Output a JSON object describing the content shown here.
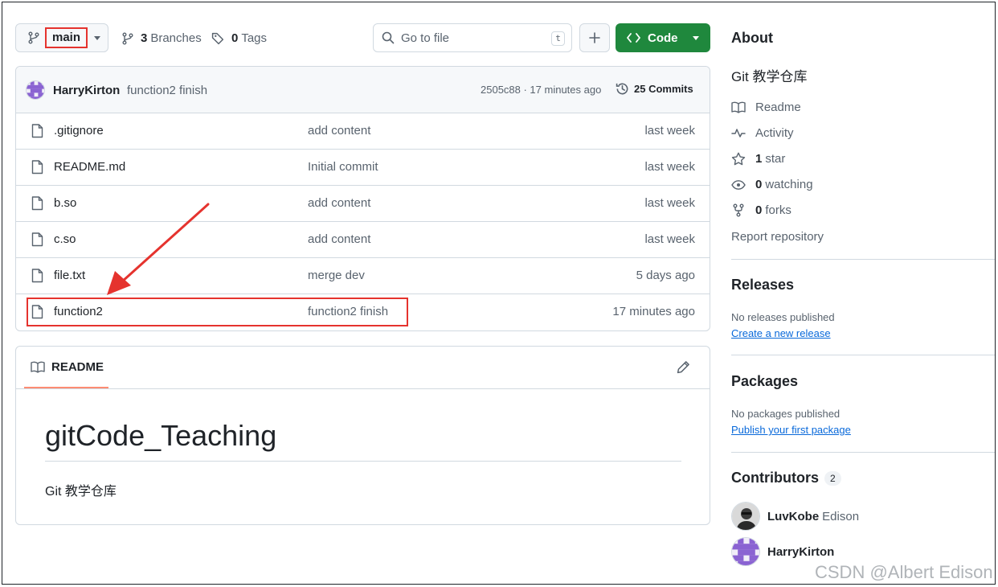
{
  "toolbar": {
    "branch": "main",
    "branches_count": "3",
    "branches_label": "Branches",
    "tags_count": "0",
    "tags_label": "Tags",
    "search_placeholder": "Go to file",
    "search_shortcut": "t",
    "code_label": "Code"
  },
  "commit": {
    "author": "HarryKirton",
    "message": "function2 finish",
    "hash_time": "2505c88 · 17 minutes ago",
    "commits_label": "25 Commits"
  },
  "files": [
    {
      "name": ".gitignore",
      "message": "add content",
      "date": "last week"
    },
    {
      "name": "README.md",
      "message": "Initial commit",
      "date": "last week"
    },
    {
      "name": "b.so",
      "message": "add content",
      "date": "last week"
    },
    {
      "name": "c.so",
      "message": "add content",
      "date": "last week"
    },
    {
      "name": "file.txt",
      "message": "merge dev",
      "date": "5 days ago"
    },
    {
      "name": "function2",
      "message": "function2 finish",
      "date": "17 minutes ago"
    }
  ],
  "readme": {
    "tab_label": "README",
    "title": "gitCode_Teaching",
    "body": "Git 教学仓库"
  },
  "about": {
    "heading": "About",
    "description": "Git 教学仓库",
    "readme": "Readme",
    "activity": "Activity",
    "stars_count": "1",
    "stars_label": "star",
    "watching_count": "0",
    "watching_label": "watching",
    "forks_count": "0",
    "forks_label": "forks",
    "report": "Report repository"
  },
  "releases": {
    "heading": "Releases",
    "empty": "No releases published",
    "link": "Create a new release"
  },
  "packages": {
    "heading": "Packages",
    "empty": "No packages published",
    "link": "Publish your first package"
  },
  "contributors": {
    "heading": "Contributors",
    "count": "2",
    "list": [
      {
        "login": "LuvKobe",
        "name": "Edison"
      },
      {
        "login": "HarryKirton",
        "name": ""
      }
    ]
  },
  "watermark": "CSDN @Albert Edison",
  "colors": {
    "accent_green": "#1f883d",
    "link_blue": "#0969da",
    "annotation_red": "#e5332e",
    "avatar_purple": "#8a63d2"
  }
}
